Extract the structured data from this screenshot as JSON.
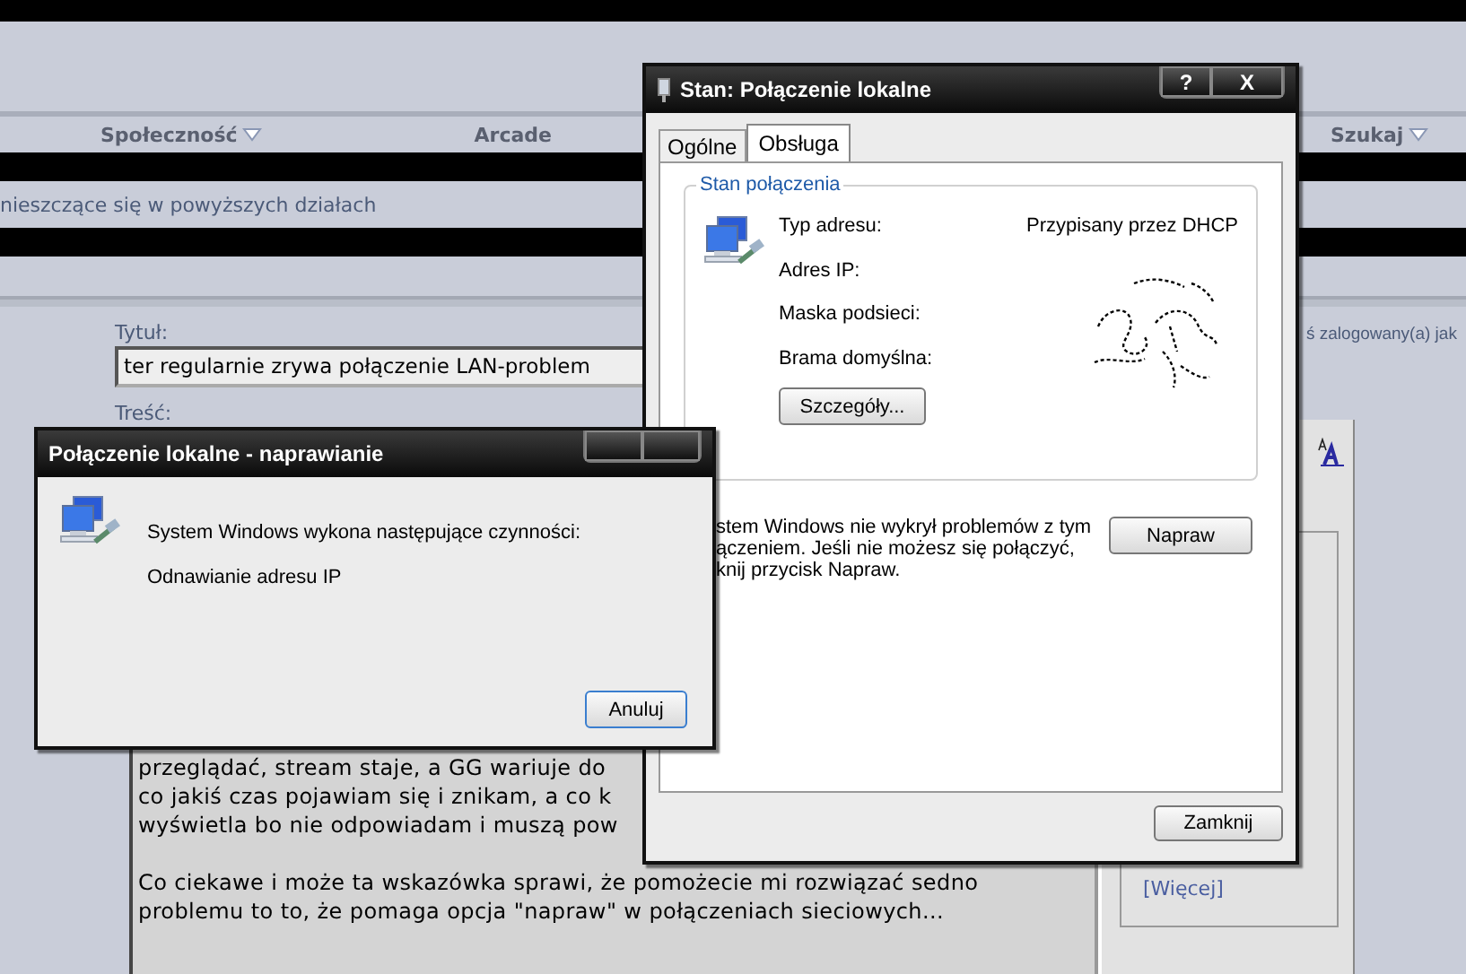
{
  "forum": {
    "nav": [
      {
        "label": "Społeczność",
        "dropdown": true
      },
      {
        "label": "Arcade",
        "dropdown": false
      },
      {
        "label": "Szukaj",
        "dropdown": true
      }
    ],
    "notice": "nieszczące się w powyższych działach",
    "login_note": "ś zalogowany(a) jak",
    "title_label": "Tytuł:",
    "title_value": "ter regularnie zrywa połączenie LAN-problem",
    "body_label": "Treść:",
    "body_paragraphs": [
      [
        "przeglądać, stream staje, a GG wariuje do",
        "co jakiś czas pojawiam się i znikam, a co k",
        "wyświetla bo nie odpowiadam i muszą pow"
      ],
      [
        "Co ciekawe i może ta wskazówka sprawi, że pomożecie mi rozwiązać sedno",
        "problemu to to, że pomaga opcja \"napraw\" w połączeniach sieciowych..."
      ]
    ],
    "more_link": "[Więcej]"
  },
  "status_dialog": {
    "title": "Stan: Połączenie lokalne",
    "window_buttons": [
      "?",
      "X"
    ],
    "tabs": [
      {
        "label": "Ogólne",
        "selected": false
      },
      {
        "label": "Obsługa",
        "selected": true
      }
    ],
    "group_title": "Stan połączenia",
    "fields": [
      {
        "label": "Typ adresu:",
        "value": "Przypisany przez DHCP"
      },
      {
        "label": "Adres IP:"
      },
      {
        "label": "Maska podsieci:"
      },
      {
        "label": "Brama domyślna:"
      }
    ],
    "details_button": "Szczegóły...",
    "repair_text_lines": [
      "stem Windows nie wykrył problemów z tym",
      "ączeniem. Jeśli nie możesz się połączyć,",
      "knij przycisk Napraw."
    ],
    "repair_button": "Napraw",
    "close_button": "Zamknij"
  },
  "repair_dialog": {
    "title": "Połączenie lokalne - naprawianie",
    "message": "System Windows wykona następujące czynności:",
    "step": "Odnawianie adresu IP",
    "cancel_button": "Anuluj"
  }
}
